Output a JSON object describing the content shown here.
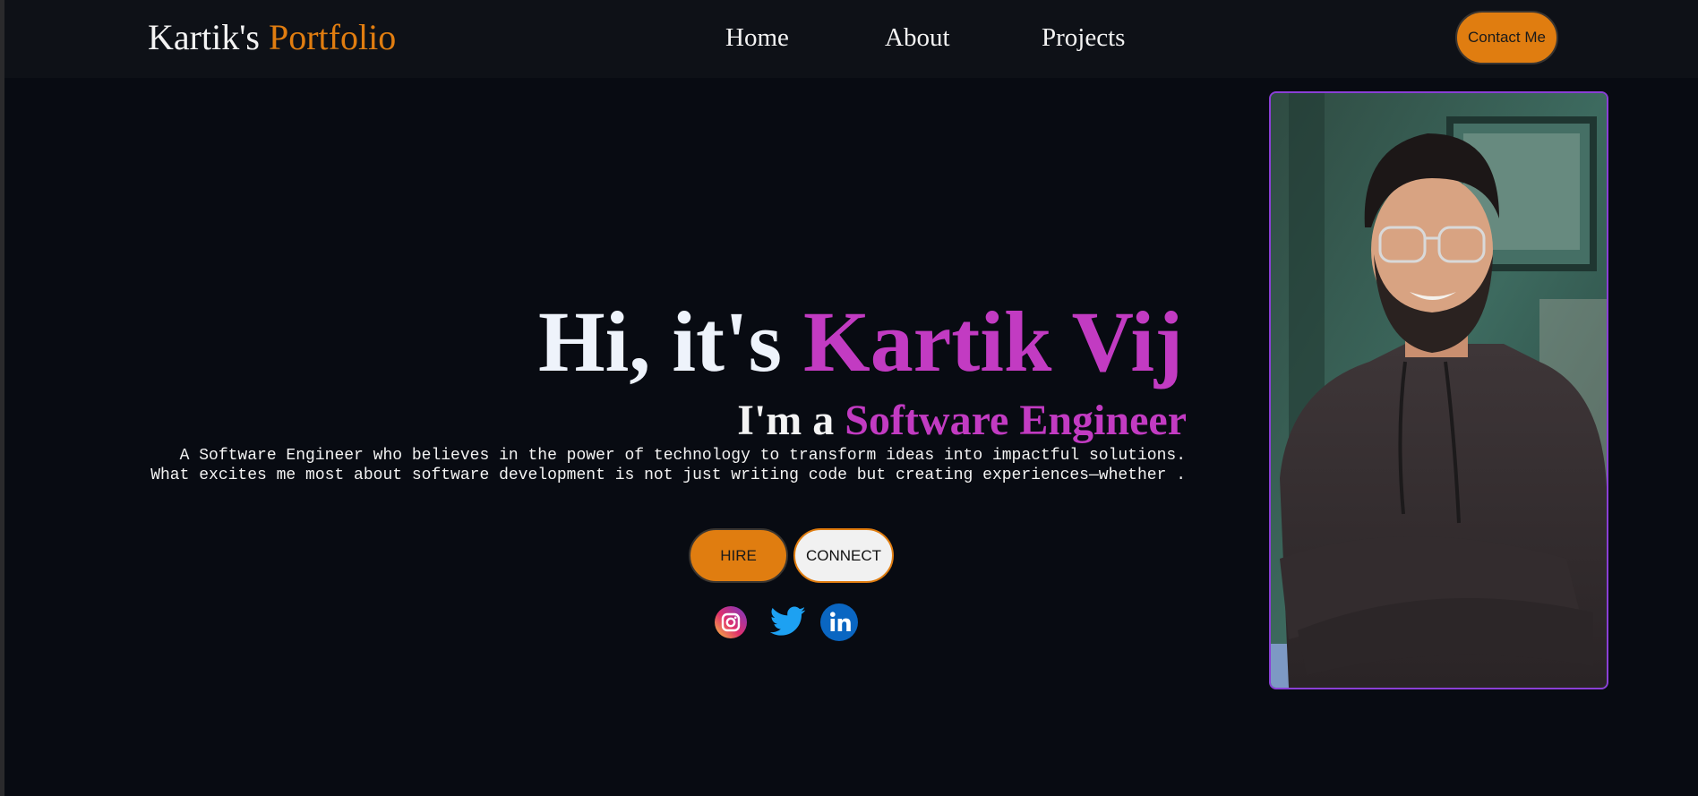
{
  "navbar": {
    "logo_first": "Kartik's",
    "logo_accent": "Portfolio",
    "links": [
      {
        "label": "Home"
      },
      {
        "label": "About"
      },
      {
        "label": "Projects"
      }
    ],
    "contact_label": "Contact Me"
  },
  "hero": {
    "greeting": "Hi, it's",
    "name": "Kartik Vij",
    "sub_prefix": "I'm a",
    "role": "Software Engineer",
    "desc_line1": "A Software Engineer who believes in the power of technology to transform ideas into impactful solutions.",
    "desc_line2": "What excites me most about software development is not just writing code but creating experiences—whether .",
    "hire_label": "HIRE",
    "connect_label": "CONNECT"
  },
  "socials": [
    {
      "icon": "instagram-icon"
    },
    {
      "icon": "twitter-icon"
    },
    {
      "icon": "linkedin-icon"
    }
  ],
  "colors": {
    "background": "#080b12",
    "navbar": "#0e1117",
    "accent_orange": "#e07d10",
    "accent_purple": "#c23bc2",
    "photo_border": "#8a3fd6"
  }
}
